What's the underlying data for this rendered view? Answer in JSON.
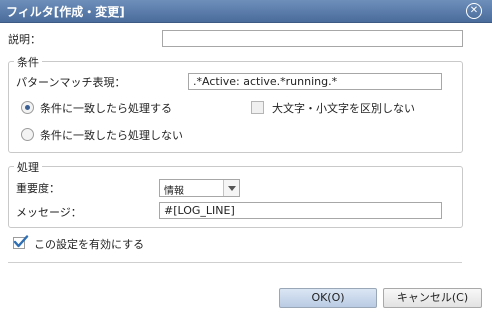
{
  "dialog": {
    "title": "フィルタ[作成・変更]",
    "close_glyph": "✕"
  },
  "description": {
    "label": "説明：",
    "value": ""
  },
  "condition": {
    "legend": "条件",
    "pattern_label": "パターンマッチ表現：",
    "pattern_value": ".*Active: active.*running.*",
    "radio_match_label": "条件に一致したら処理する",
    "radio_nomatch_label": "条件に一致したら処理しない",
    "ignore_case_label": "大文字・小文字を区別しない",
    "radio_match_selected": true,
    "ignore_case_checked": false
  },
  "processing": {
    "legend": "処理",
    "severity_label": "重要度：",
    "severity_value": "情報",
    "message_label": "メッセージ：",
    "message_value": "#[LOG_LINE]"
  },
  "enable": {
    "label": "この設定を有効にする",
    "checked": true
  },
  "buttons": {
    "ok": "OK(O)",
    "cancel": "キャンセル(C)"
  },
  "colors": {
    "titlebar": "#4a6c9c",
    "accent": "#3a5f94"
  }
}
